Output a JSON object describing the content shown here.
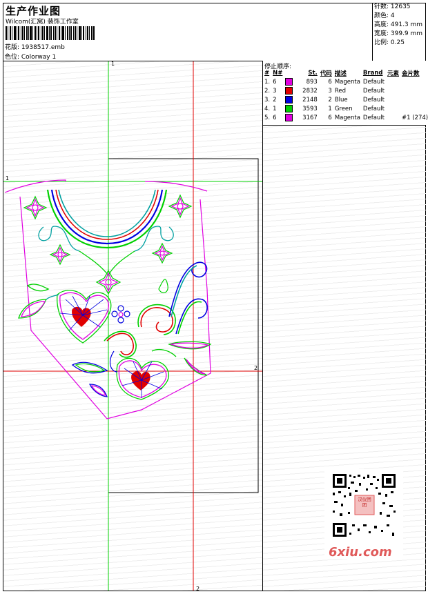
{
  "header": {
    "title": "生产作业图",
    "subtitle": "Wilcom(汇窝) 装饰工作室",
    "pattern_label": "花版: 1938517.emb",
    "colorway_label": "色位: Colorway 1"
  },
  "stats": {
    "stitches": "针数: 12635",
    "colors": "颜色: 4",
    "height": "高度: 491.3 mm",
    "width": "宽度: 399.9 mm",
    "scale": "比例: 0.25"
  },
  "stop_sequence": {
    "title": "停止顺序:",
    "columns": [
      "#",
      "N#",
      "St.",
      "代码",
      "描述",
      "Brand",
      "元素",
      "金片数"
    ],
    "rows": [
      {
        "idx": "1.",
        "n": "6",
        "color": "#e000e0",
        "st": "893",
        "code": "6",
        "desc": "Magenta",
        "brand": "Default",
        "elem": "",
        "seq": ""
      },
      {
        "idx": "2.",
        "n": "3",
        "color": "#e00000",
        "st": "2832",
        "code": "3",
        "desc": "Red",
        "brand": "Default",
        "elem": "",
        "seq": ""
      },
      {
        "idx": "3.",
        "n": "2",
        "color": "#0000e0",
        "st": "2148",
        "code": "2",
        "desc": "Blue",
        "brand": "Default",
        "elem": "",
        "seq": ""
      },
      {
        "idx": "4.",
        "n": "1",
        "color": "#00d000",
        "st": "3593",
        "code": "1",
        "desc": "Green",
        "brand": "Default",
        "elem": "",
        "seq": ""
      },
      {
        "idx": "5.",
        "n": "6",
        "color": "#e000e0",
        "st": "3167",
        "code": "6",
        "desc": "Magenta",
        "brand": "Default",
        "elem": "",
        "seq": "#1 (274)"
      }
    ]
  },
  "axis_markers": {
    "v1_top": "1",
    "h1_left": "1",
    "h2_right": "2",
    "v2_bottom": "2"
  },
  "watermark": "6xiu.com",
  "qr_stamp": "汉仪团团",
  "colors": {
    "magenta": "#e000e0",
    "red": "#e00000",
    "blue": "#0000e0",
    "green": "#00d000",
    "cyan": "#00a0a0"
  }
}
